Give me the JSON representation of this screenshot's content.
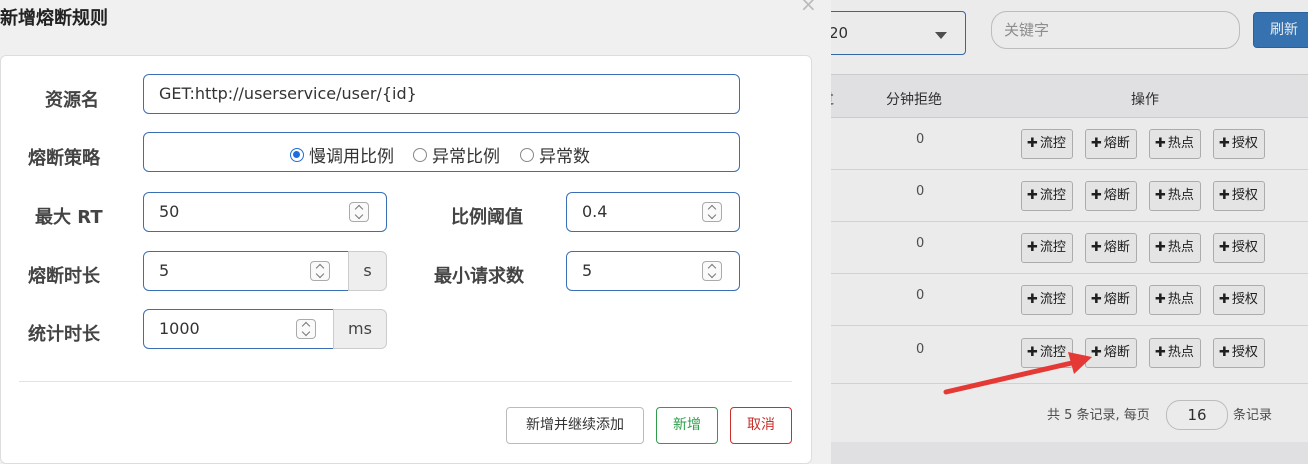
{
  "background": {
    "page_select_value": "20",
    "keyword_placeholder": "关键字",
    "refresh_label": "刷新",
    "table_headers": [
      "通过",
      "分钟拒绝",
      "操作"
    ],
    "rows": [
      {
        "reject_count": "0"
      },
      {
        "reject_count": ""
      },
      {
        "reject_count": ""
      },
      {
        "reject_count": ""
      },
      {
        "reject_count": "0"
      }
    ],
    "row_counts": [
      "0",
      "0",
      "0",
      "0",
      "0"
    ],
    "op_buttons": [
      "流控",
      "熔断",
      "热点",
      "授权"
    ],
    "pager": {
      "prefix": "共 5 条记录, 每页",
      "page_size": "16",
      "suffix": "条记录"
    }
  },
  "modal": {
    "title": "新增熔断规则",
    "close_glyph": "×",
    "fields": {
      "resource": {
        "label": "资源名",
        "value": "GET:http://userservice/user/{id}"
      },
      "strategy": {
        "label": "熔断策略",
        "options": [
          "慢调用比例",
          "异常比例",
          "异常数"
        ],
        "selected": "慢调用比例"
      },
      "max_rt": {
        "label": "最大 RT",
        "value": "50"
      },
      "ratio": {
        "label": "比例阈值",
        "value": "0.4"
      },
      "duration": {
        "label": "熔断时长",
        "value": "5",
        "unit": "s"
      },
      "min_requests": {
        "label": "最小请求数",
        "value": "5"
      },
      "stat_interval": {
        "label": "统计时长",
        "value": "1000",
        "unit": "ms"
      }
    },
    "buttons": {
      "add_continue": "新增并继续添加",
      "add": "新增",
      "cancel": "取消"
    }
  },
  "colors": {
    "accent": "#3b6fb5",
    "success": "#2e9e4a",
    "danger": "#c9302c",
    "arrow": "#e53935"
  }
}
